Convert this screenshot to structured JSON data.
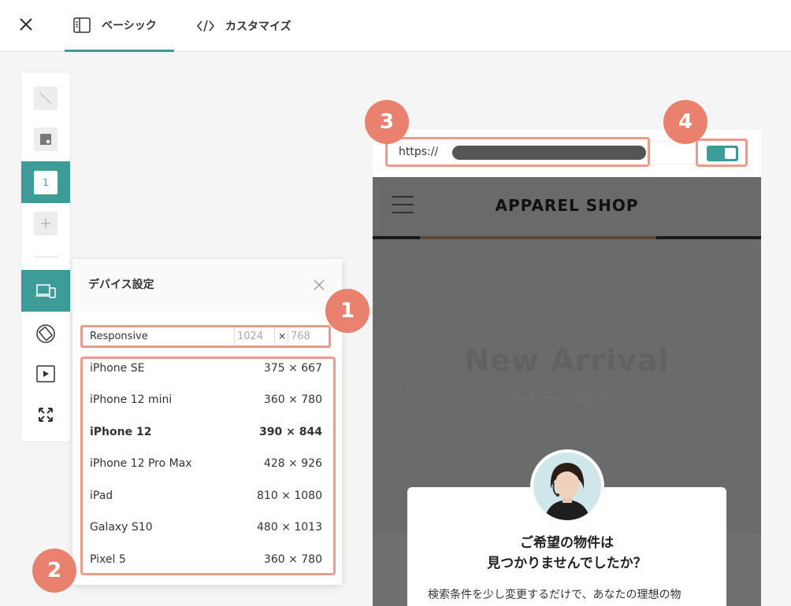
{
  "topbar": {
    "tabs": [
      {
        "label": "ベーシック",
        "icon": "sidebar-panel-icon",
        "active": true
      },
      {
        "label": "カスタマイズ",
        "icon": "code-icon",
        "active": false
      }
    ],
    "close_icon": "close-icon"
  },
  "toolbar": {
    "items": [
      {
        "name": "no-fill-icon"
      },
      {
        "name": "image-block-icon"
      },
      {
        "name": "page-number",
        "label": "1",
        "active": true
      },
      {
        "name": "add-icon"
      },
      {
        "name": "device-icon",
        "active": true
      },
      {
        "name": "rotate-icon"
      },
      {
        "name": "play-icon"
      },
      {
        "name": "fullscreen-icon"
      }
    ]
  },
  "device_panel": {
    "title": "デバイス設定",
    "responsive": {
      "label": "Responsive",
      "width": "1024",
      "x": "×",
      "height": "768"
    },
    "devices": [
      {
        "name": "iPhone SE",
        "size": "375 × 667",
        "selected": false
      },
      {
        "name": "iPhone 12 mini",
        "size": "360 × 780",
        "selected": false
      },
      {
        "name": "iPhone 12",
        "size": "390 × 844",
        "selected": true
      },
      {
        "name": "iPhone 12 Pro Max",
        "size": "428 × 926",
        "selected": false
      },
      {
        "name": "iPad",
        "size": "810 × 1080",
        "selected": false
      },
      {
        "name": "Galaxy S10",
        "size": "480 × 1013",
        "selected": false
      },
      {
        "name": "Pixel 5",
        "size": "360 × 780",
        "selected": false
      }
    ]
  },
  "badges": [
    "1",
    "2",
    "3",
    "4"
  ],
  "preview": {
    "url_prefix": "https://",
    "toggle_on": true,
    "site": {
      "title": "APPAREL SHOP",
      "hero_title": "New Arrival",
      "hero_subtitle": "Autumn - Winter"
    },
    "chat": {
      "question_line1": "ご希望の物件は",
      "question_line2": "見つかりませんでしたか？",
      "body": "検索条件を少し変更するだけで、あなたの理想の物"
    }
  },
  "colors": {
    "accent": "#3d9b98",
    "highlight_border": "#ec9a8c",
    "badge": "#e9816e"
  }
}
